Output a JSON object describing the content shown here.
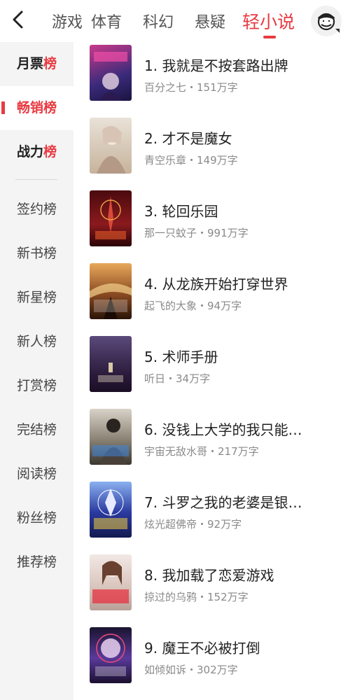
{
  "header": {
    "back_icon": "chevron-left-icon",
    "tabs": [
      {
        "label": "游戏"
      },
      {
        "label": "体育"
      },
      {
        "label": "科幻"
      },
      {
        "label": "悬疑"
      },
      {
        "label": "轻小说"
      }
    ],
    "active_tab": "轻小说",
    "avatar_icon": "user-avatar-icon",
    "accent_color": "#e83a41"
  },
  "sidebar": {
    "items": [
      {
        "label_main": "月票",
        "label_accent": "榜"
      },
      {
        "label_main": "畅销榜",
        "label_accent": ""
      },
      {
        "label_main": "战力",
        "label_accent": "榜"
      },
      {
        "label": "签约榜"
      },
      {
        "label": "新书榜"
      },
      {
        "label": "新星榜"
      },
      {
        "label": "新人榜"
      },
      {
        "label": "打赏榜"
      },
      {
        "label": "完结榜"
      },
      {
        "label": "阅读榜"
      },
      {
        "label": "粉丝榜"
      },
      {
        "label": "推荐榜"
      }
    ],
    "active_item": "畅销榜"
  },
  "books": [
    {
      "title": "1. 我就是不按套路出牌",
      "author": "百分之七",
      "words": "151万字",
      "meta": "百分之七・151万字",
      "cover_color": "#5a4b9a"
    },
    {
      "title": "2. 才不是魔女",
      "author": "青空乐章",
      "words": "149万字",
      "meta": "青空乐章・149万字",
      "cover_color": "#c9b9a6"
    },
    {
      "title": "3. 轮回乐园",
      "author": "那一只蚊子",
      "words": "991万字",
      "meta": "那一只蚊子・991万字",
      "cover_color": "#7a1418"
    },
    {
      "title": "4. 从龙族开始打穿世界",
      "author": "起飞的大象",
      "words": "94万字",
      "meta": "起飞的大象・94万字",
      "cover_color": "#7a4a2a"
    },
    {
      "title": "5. 术师手册",
      "author": "听日",
      "words": "34万字",
      "meta": "听日・34万字",
      "cover_color": "#3e2f50"
    },
    {
      "title": "6. 没钱上大学的我只能…",
      "author": "宇宙无敌水哥",
      "words": "217万字",
      "meta": "宇宙无敌水哥・217万字",
      "cover_color": "#8a8070"
    },
    {
      "title": "7. 斗罗之我的老婆是银…",
      "author": "炫光超佛帝",
      "words": "92万字",
      "meta": "炫光超佛帝・92万字",
      "cover_color": "#2a3a8a"
    },
    {
      "title": "8. 我加载了恋爱游戏",
      "author": "掠过的乌鸦",
      "words": "152万字",
      "meta": "掠过的乌鸦・152万字",
      "cover_color": "#d9c7c0"
    },
    {
      "title": "9. 魔王不必被打倒",
      "author": "如倾如诉",
      "words": "302万字",
      "meta": "如倾如诉・302万字",
      "cover_color": "#4a3a7a"
    }
  ]
}
